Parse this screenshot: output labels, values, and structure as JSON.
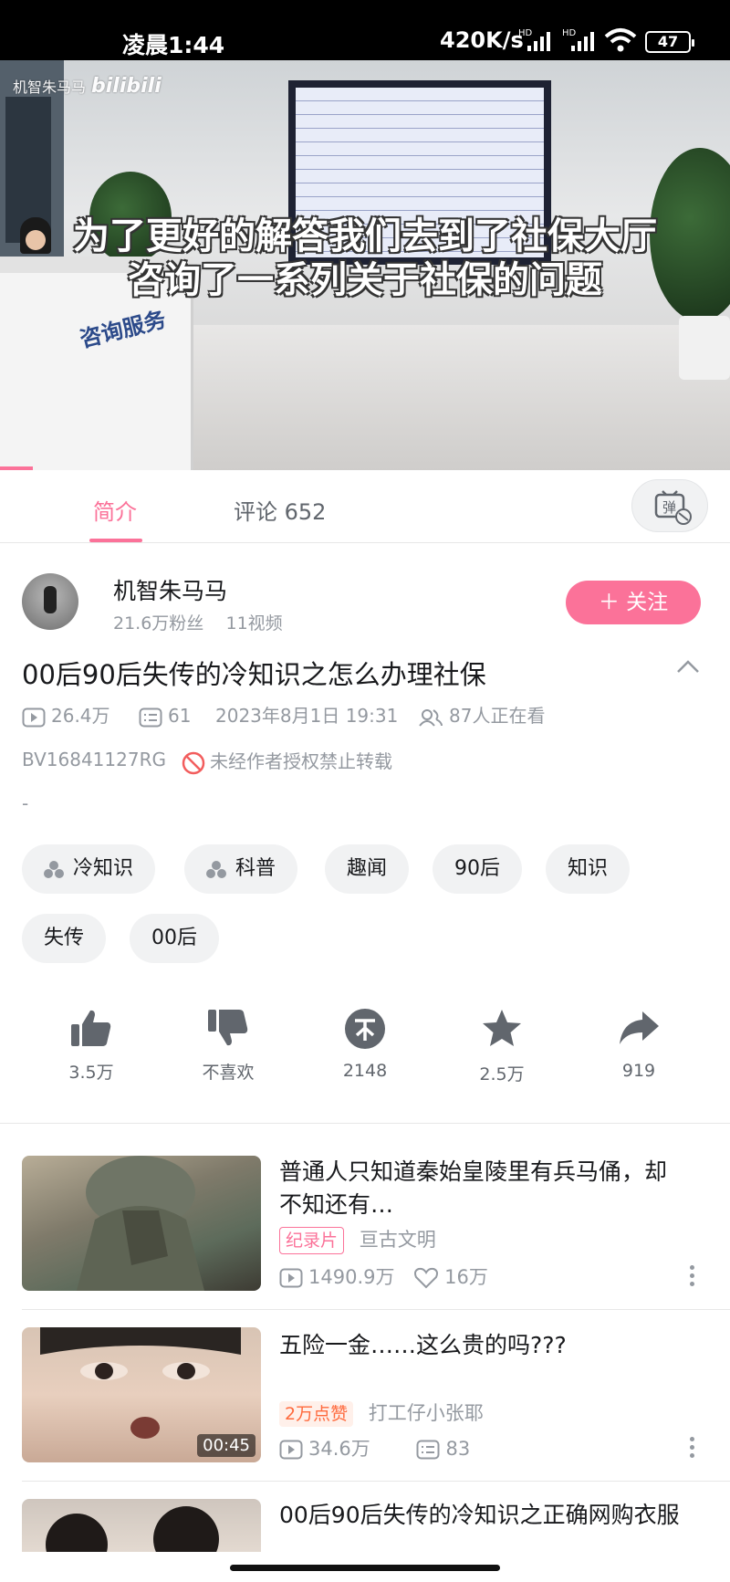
{
  "status_bar": {
    "time": "凌晨1:44",
    "speed": "420K/s",
    "signal_label": "HD",
    "battery": "47"
  },
  "player": {
    "watermark_name": "机智朱马马",
    "watermark_logo": "bilibili",
    "desk_sign": "咨询服务",
    "subtitle_line1": "为了更好的解答我们去到了社保大厅",
    "subtitle_line2": "咨询了一系列关于社保的问题",
    "progress_fraction": 0.045
  },
  "tabs": [
    {
      "label": "简介",
      "active": true
    },
    {
      "label": "评论 652",
      "active": false
    }
  ],
  "danmaku_icon": "danmaku-off-icon",
  "author": {
    "name": "机智朱马马",
    "fans": "21.6万粉丝",
    "videos": "11视频",
    "follow_label": "＋ 关注"
  },
  "video": {
    "title": "00后90后失传的冷知识之怎么办理社保",
    "views": "26.4万",
    "danmaku": "61",
    "date": "2023年8月1日 19:31",
    "watching": "87人正在看",
    "bvid": "BV16841127RG",
    "no_repost": "未经作者授权禁止转载",
    "description": "-"
  },
  "tags": [
    "冷知识",
    "科普",
    "趣闻",
    "90后",
    "知识",
    "失传",
    "00后"
  ],
  "actions": [
    {
      "icon": "like-icon",
      "label": "3.5万"
    },
    {
      "icon": "dislike-icon",
      "label": "不喜欢"
    },
    {
      "icon": "coin-icon",
      "label": "2148"
    },
    {
      "icon": "favorite-icon",
      "label": "2.5万"
    },
    {
      "icon": "share-icon",
      "label": "919"
    }
  ],
  "recommendations": [
    {
      "title": "普通人只知道秦始皇陵里有兵马俑，却不知还有…",
      "badge": "纪录片",
      "uploader": "亘古文明",
      "views": "1490.9万",
      "likes": "16万"
    },
    {
      "title": "五险一金……这么贵的吗???",
      "badge": "2万点赞",
      "uploader": "打工仔小张耶",
      "views": "34.6万",
      "danmaku": "83",
      "duration": "00:45"
    },
    {
      "title": "00后90后失传的冷知识之正确网购衣服"
    }
  ],
  "colors": {
    "accent": "#fb7299",
    "text_secondary": "#9499a0",
    "tag_bg": "#f1f2f3"
  }
}
